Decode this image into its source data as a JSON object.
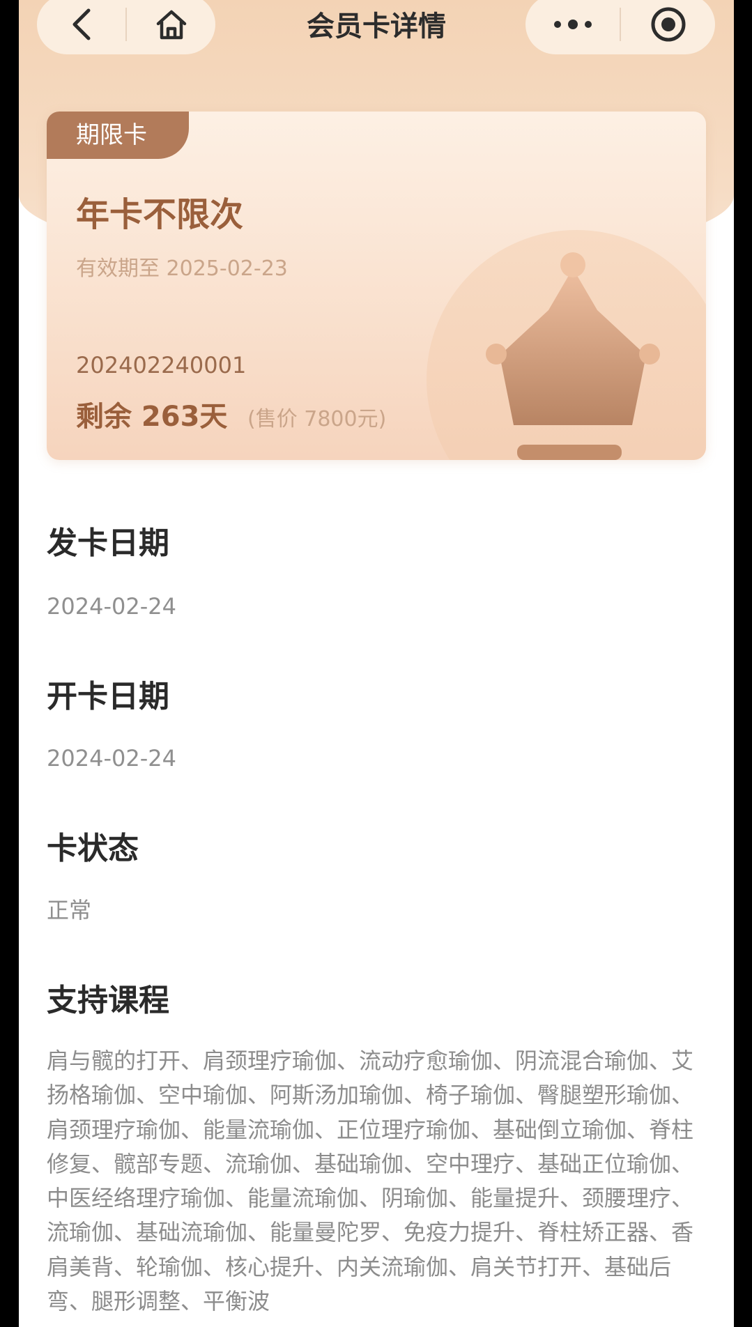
{
  "nav": {
    "title": "会员卡详情",
    "back_icon": "chevron-left-icon",
    "home_icon": "home-icon",
    "more_icon": "more-dots-icon",
    "close_icon": "target-circle-icon"
  },
  "card": {
    "tag": "期限卡",
    "title": "年卡不限次",
    "valid_until": "有效期至 2025-02-23",
    "card_number": "202402240001",
    "remaining": "剩余 263天",
    "price": "(售价 7800元)",
    "decoration_icon": "crown-icon",
    "colors": {
      "tag": "#b27b5a",
      "title": "#9a5f3b",
      "header_bg": "#f3d3b5"
    }
  },
  "issue_date": {
    "label": "发卡日期",
    "value": "2024-02-24"
  },
  "open_date": {
    "label": "开卡日期",
    "value": "2024-02-24"
  },
  "status": {
    "label": "卡状态",
    "value": "正常"
  },
  "courses": {
    "label": "支持课程",
    "text": "肩与髋的打开、肩颈理疗瑜伽、流动疗愈瑜伽、阴流混合瑜伽、艾扬格瑜伽、空中瑜伽、阿斯汤加瑜伽、椅子瑜伽、臀腿塑形瑜伽、肩颈理疗瑜伽、能量流瑜伽、正位理疗瑜伽、基础倒立瑜伽、脊柱修复、髋部专题、流瑜伽、基础瑜伽、空中理疗、基础正位瑜伽、中医经络理疗瑜伽、能量流瑜伽、阴瑜伽、能量提升、颈腰理疗、流瑜伽、基础流瑜伽、能量曼陀罗、免疫力提升、脊柱矫正器、香肩美背、轮瑜伽、核心提升、内关流瑜伽、肩关节打开、基础后弯、腿形调整、平衡波"
  }
}
